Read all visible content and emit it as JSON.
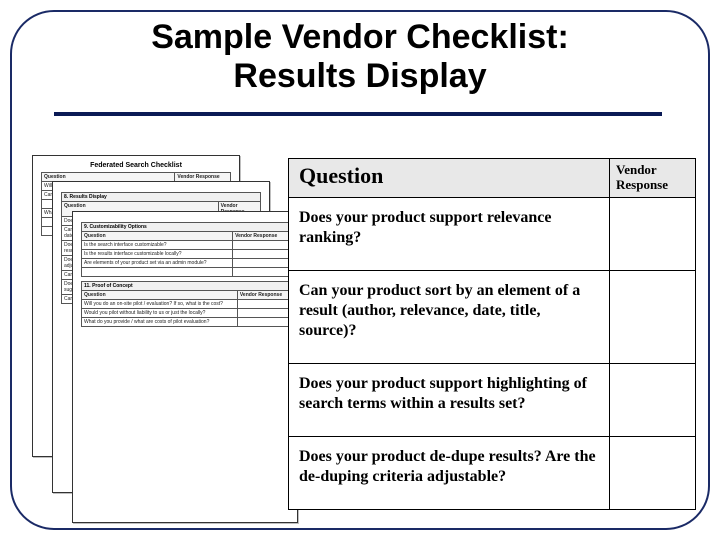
{
  "title_line1": "Sample Vendor Checklist:",
  "title_line2": "Results Display",
  "main_table": {
    "headers": {
      "question": "Question",
      "response": "Vendor Response"
    },
    "rows": [
      {
        "q": "Does your product support relevance ranking?"
      },
      {
        "q": "Can your product sort by an element of a result (author, relevance, date, title, source)?"
      },
      {
        "q": "Does your product support highlighting of search terms within a results set?"
      },
      {
        "q": "Does your product de-dupe results?  Are the de-duping criteria adjustable?"
      }
    ]
  },
  "stack": {
    "back_title": "Federated Search Checklist",
    "mid_section": "8.  Results Display",
    "front_section_a": "9.  Customizability Options",
    "front_section_b": "11.  Proof of Concept",
    "col_q": "Question",
    "col_r": "Vendor Response"
  }
}
